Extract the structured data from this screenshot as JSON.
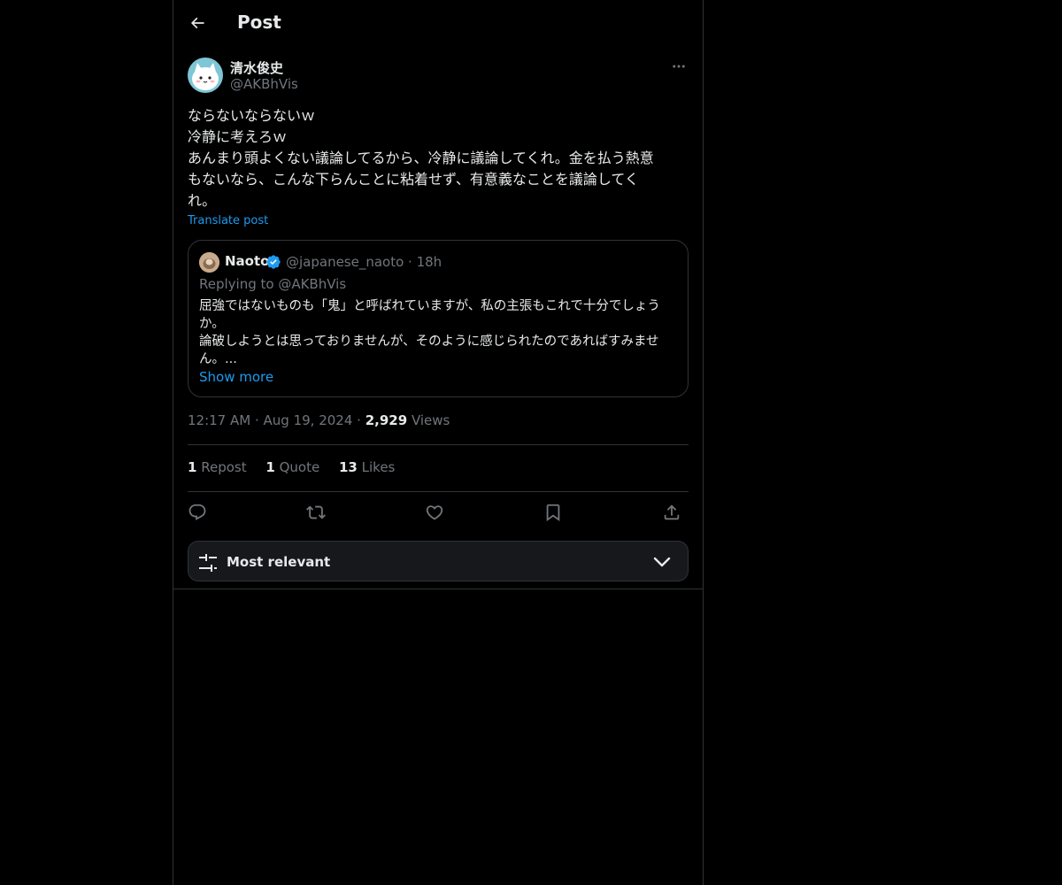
{
  "header": {
    "title": "Post",
    "back_icon": "arrow-left-icon"
  },
  "post": {
    "author": {
      "display_name": "清水俊史",
      "handle": "@AKBhVis"
    },
    "text_lines": [
      "ならないならないｗ",
      "冷静に考えろｗ",
      "あんまり頭よくない議論してるから、冷静に議論してくれ。金を払う熱意",
      "もないなら、こんな下らんことに粘着せず、有意義なことを議論してく",
      "れ。"
    ],
    "translate_label": "Translate post",
    "quoted": {
      "display_name": "Naoto",
      "handle_time": "@japanese_naoto · 18h",
      "replying_to": "Replying to @AKBhVis",
      "text_lines": [
        "屈強ではないものも「鬼」と呼ばれていますが、私の主張もこれで十分でしょう",
        "か。",
        "論破しようとは思っておりませんが、そのように感じられたのであればすみませ",
        "ん。..."
      ],
      "show_more": "Show more",
      "verified": true
    },
    "time": "12:17 AM",
    "date": "Aug 19, 2024",
    "views_count": "2,929",
    "views_label": "Views",
    "stats": {
      "reposts_count": "1",
      "reposts_label": "Repost",
      "quotes_count": "1",
      "quotes_label": "Quote",
      "likes_count": "13",
      "likes_label": "Likes"
    },
    "actions": [
      "reply-icon",
      "repost-icon",
      "like-icon",
      "bookmark-icon",
      "share-icon"
    ]
  },
  "replies_sort": {
    "label": "Most relevant"
  },
  "colors": {
    "background": "#000000",
    "text": "#e7e9ea",
    "muted": "#71767b",
    "accent": "#1d9bf0",
    "border": "#2f3336"
  }
}
